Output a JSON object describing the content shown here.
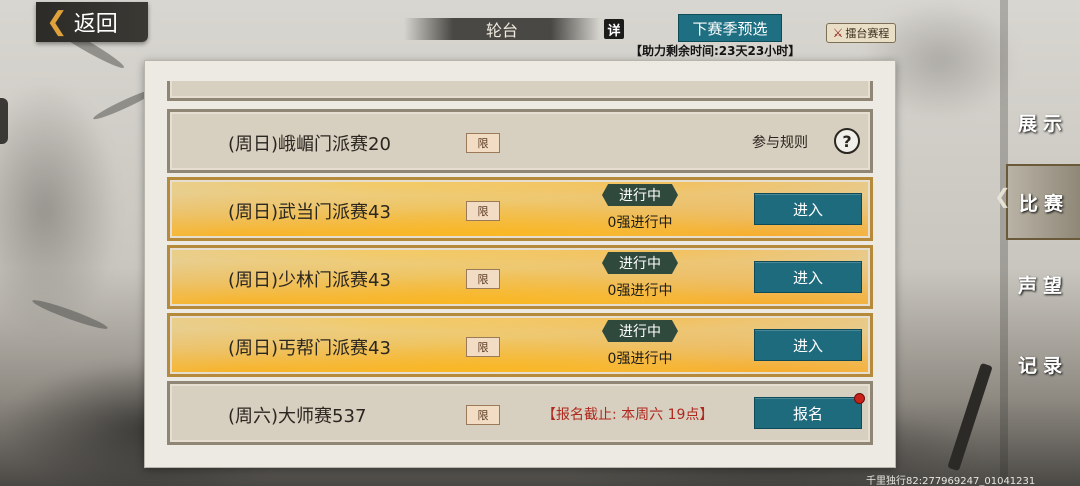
{
  "top_bar": {
    "back_label": "返回",
    "round_tab_label": "轮台",
    "detail_label": "详",
    "next_season_label": "下赛季预选",
    "schedule_label": "擂台赛程",
    "countdown_text": "【助力剩余时间:23天23小时】"
  },
  "rows": [
    {
      "name": "(周日)峨嵋门派赛20",
      "limit_label": "限",
      "rules_label": "参与规则",
      "help_icon": "?"
    },
    {
      "name": "(周日)武当门派赛43",
      "limit_label": "限",
      "status": "进行中",
      "status_sub": "0强进行中",
      "action_label": "进入"
    },
    {
      "name": "(周日)少林门派赛43",
      "limit_label": "限",
      "status": "进行中",
      "status_sub": "0强进行中",
      "action_label": "进入"
    },
    {
      "name": "(周日)丐帮门派赛43",
      "limit_label": "限",
      "status": "进行中",
      "status_sub": "0强进行中",
      "action_label": "进入"
    },
    {
      "name": "(周六)大师赛537",
      "limit_label": "限",
      "deadline": "【报名截止: 本周六 19点】",
      "action_label": "报名"
    }
  ],
  "side_tabs": [
    {
      "label": "展示",
      "selected": false
    },
    {
      "label": "比赛",
      "selected": true
    },
    {
      "label": "声望",
      "selected": false
    },
    {
      "label": "记录",
      "selected": false
    }
  ],
  "footer_id": "千里独行82:277969247_01041231",
  "colors": {
    "teal_button": "#1f6b7e",
    "status_pill": "#2f4a3c",
    "deadline_red": "#b0281e",
    "flame_orange": "#ffaa00"
  }
}
